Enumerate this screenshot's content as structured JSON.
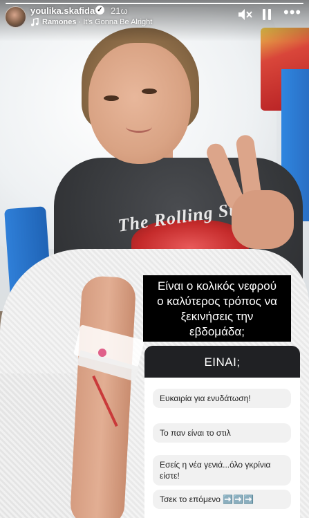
{
  "story": {
    "progress": 1.0,
    "username": "youlika.skafida",
    "verified": true,
    "time_ago": "21ω",
    "music": {
      "artist": "Ramones",
      "separator": " · ",
      "song": "It's Gonna Be Alright"
    },
    "icons": {
      "mute": "speaker-muted-icon",
      "pause": "pause-icon",
      "more": "more-options-icon",
      "music": "music-note-icon",
      "verified": "verified-badge-icon"
    },
    "photo_shirt_text": "The Rolling St"
  },
  "question": {
    "lines": [
      "Είναι ο κολικός νεφρού",
      "ο καλύτερος τρόπος να",
      "ξεκινήσεις την",
      "εβδομάδα;"
    ]
  },
  "answers": {
    "header": "ΕΙΝΑΙ;",
    "items": [
      "Ευκαιρία για ενυδάτωση!",
      "Το παν είναι το στιλ",
      "Εσείς η νέα γενιά...όλο γκρίνια είστε!",
      "Τσεκ το επόμενο ➡️➡️➡️"
    ]
  }
}
